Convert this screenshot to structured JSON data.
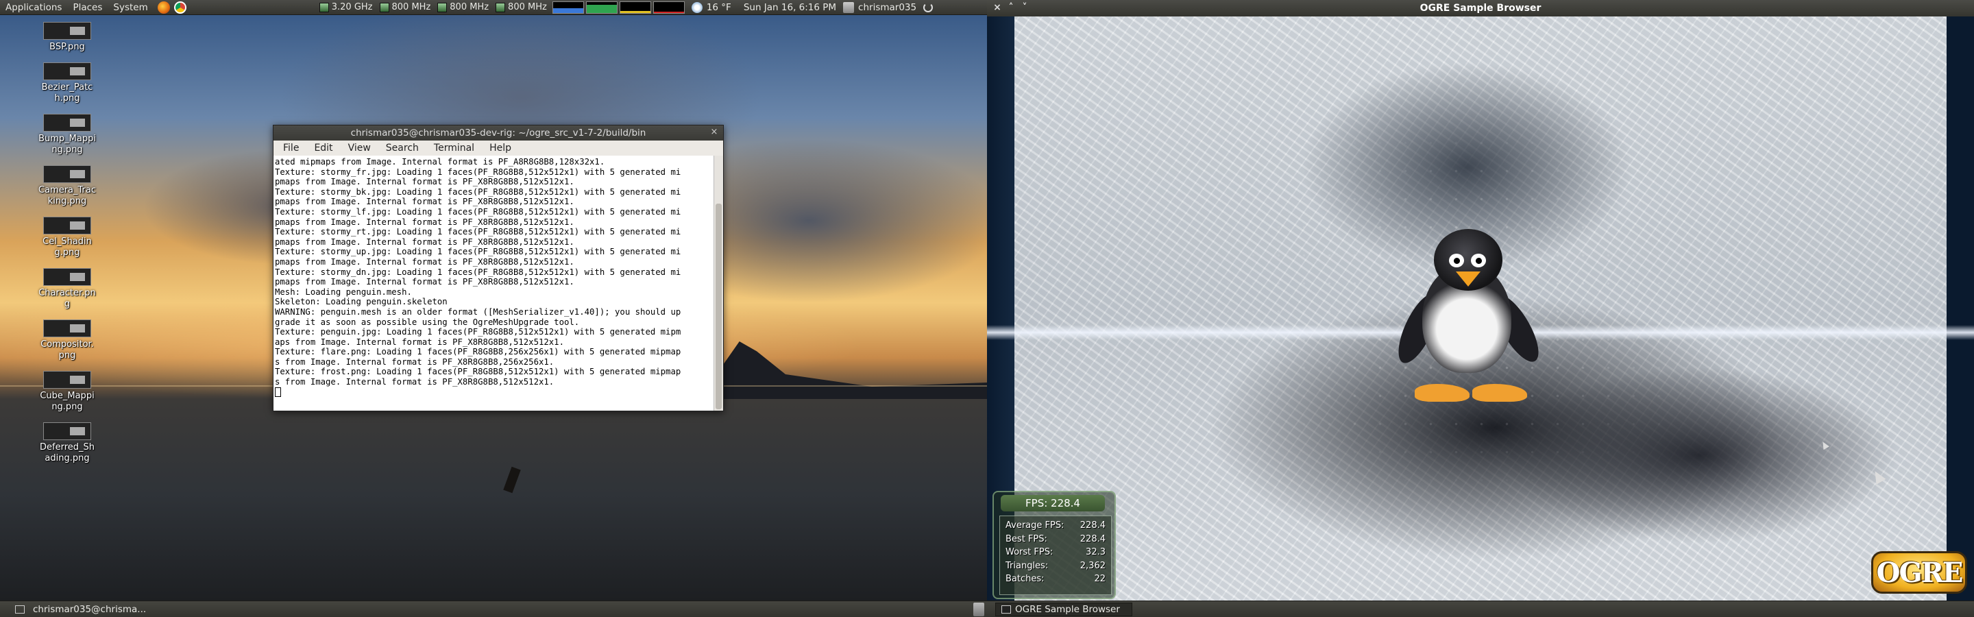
{
  "top_panel": {
    "menus": [
      "Applications",
      "Places",
      "System"
    ],
    "cpu": [
      "3.20 GHz",
      "800 MHz",
      "800 MHz",
      "800 MHz"
    ],
    "weather": "16 °F",
    "clock": "Sun Jan 16,  6:16 PM",
    "user": "chrismar035"
  },
  "desktop_icons": [
    "BSP.png",
    "Bezier_Patch.png",
    "Bump_Mapping.png",
    "Camera_Tracking.png",
    "Cel_Shading.png",
    "Character.png",
    "Compositor.png",
    "Cube_Mapping.png",
    "Deferred_Shading.png"
  ],
  "terminal": {
    "title": "chrismar035@chrismar035-dev-rig: ~/ogre_src_v1-7-2/build/bin",
    "menus": [
      "File",
      "Edit",
      "View",
      "Search",
      "Terminal",
      "Help"
    ],
    "lines": [
      "ated mipmaps from Image. Internal format is PF_A8R8G8B8,128x32x1.",
      "Texture: stormy_fr.jpg: Loading 1 faces(PF_R8G8B8,512x512x1) with 5 generated mi",
      "pmaps from Image. Internal format is PF_X8R8G8B8,512x512x1.",
      "Texture: stormy_bk.jpg: Loading 1 faces(PF_R8G8B8,512x512x1) with 5 generated mi",
      "pmaps from Image. Internal format is PF_X8R8G8B8,512x512x1.",
      "Texture: stormy_lf.jpg: Loading 1 faces(PF_R8G8B8,512x512x1) with 5 generated mi",
      "pmaps from Image. Internal format is PF_X8R8G8B8,512x512x1.",
      "Texture: stormy_rt.jpg: Loading 1 faces(PF_R8G8B8,512x512x1) with 5 generated mi",
      "pmaps from Image. Internal format is PF_X8R8G8B8,512x512x1.",
      "Texture: stormy_up.jpg: Loading 1 faces(PF_R8G8B8,512x512x1) with 5 generated mi",
      "pmaps from Image. Internal format is PF_X8R8G8B8,512x512x1.",
      "Texture: stormy_dn.jpg: Loading 1 faces(PF_R8G8B8,512x512x1) with 5 generated mi",
      "pmaps from Image. Internal format is PF_X8R8G8B8,512x512x1.",
      "Mesh: Loading penguin.mesh.",
      "Skeleton: Loading penguin.skeleton",
      "WARNING: penguin.mesh is an older format ([MeshSerializer_v1.40]); you should up",
      "grade it as soon as possible using the OgreMeshUpgrade tool.",
      "Texture: penguin.jpg: Loading 1 faces(PF_R8G8B8,512x512x1) with 5 generated mipm",
      "aps from Image. Internal format is PF_X8R8G8B8,512x512x1.",
      "Texture: flare.png: Loading 1 faces(PF_R8G8B8,256x256x1) with 5 generated mipmap",
      "s from Image. Internal format is PF_X8R8G8B8,256x256x1.",
      "Texture: frost.png: Loading 1 faces(PF_R8G8B8,512x512x1) with 5 generated mipmap",
      "s from Image. Internal format is PF_X8R8G8B8,512x512x1."
    ]
  },
  "ogre": {
    "title": "OGRE Sample Browser",
    "fps_header": "FPS: 228.4",
    "stats": [
      {
        "label": "Average FPS:",
        "value": "228.4"
      },
      {
        "label": "Best FPS:",
        "value": "228.4"
      },
      {
        "label": "Worst FPS:",
        "value": "32.3"
      },
      {
        "label": "Triangles:",
        "value": "2,362"
      },
      {
        "label": "Batches:",
        "value": "22"
      }
    ],
    "logo_text": "OGRE"
  },
  "bottom_panel": {
    "tasks": [
      "chrismar035@chrisma...",
      "OGRE Sample Browser"
    ]
  },
  "colors": {
    "panel": "#3e3e39",
    "terminal_bg": "#ffffff",
    "fps_accent": "#5a7a4a",
    "logo": "#f0b020"
  }
}
